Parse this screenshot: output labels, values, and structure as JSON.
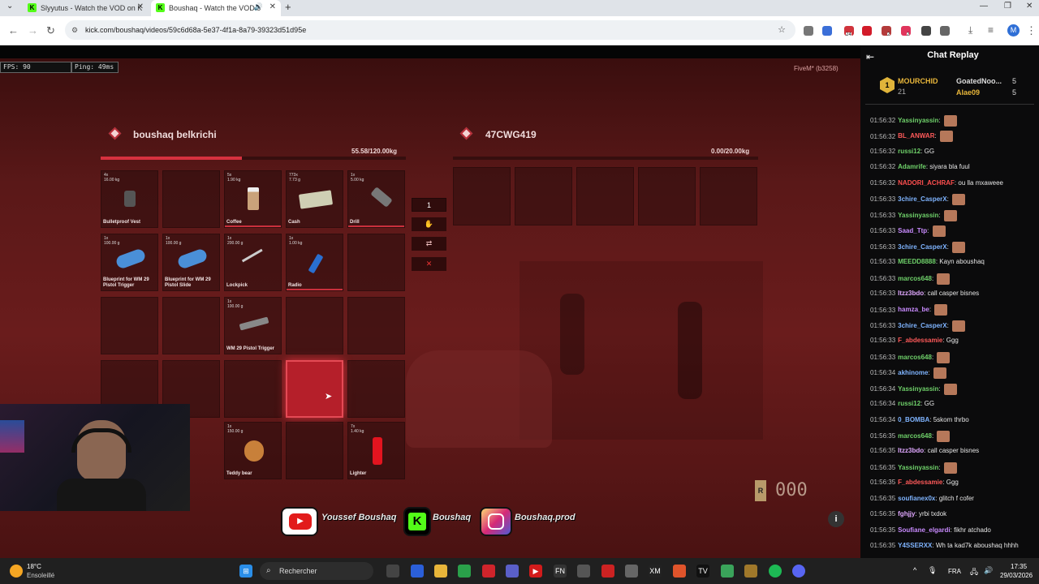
{
  "browser": {
    "tabs": [
      {
        "title": "Slyyutus - Watch the VOD on K",
        "active": false
      },
      {
        "title": "Boushaq - Watch the VOD o",
        "active": true
      }
    ],
    "url": "kick.com/boushaq/videos/59c6d68a-5e37-4f1a-8a79-39323d51d95e",
    "badges": {
      "ext1": "24",
      "ext2": "2",
      "ext3": "2"
    },
    "profile_initial": "M"
  },
  "game": {
    "fps": "FPS: 90",
    "ping": "Ping: 49ms",
    "fivem": "FiveM* (b3258)",
    "player": {
      "name": "boushaq belkrichi",
      "weight": "55.58/120.00kg",
      "weight_fraction": 0.463
    },
    "other": {
      "name": "47CWG419",
      "weight": "0.00/20.00kg",
      "weight_fraction": 0
    },
    "middle_buttons": {
      "amount": "1",
      "give": "✋",
      "swap": "⇄",
      "close": "✕"
    },
    "items": [
      {
        "count": "4x",
        "weight": "16.00 kg",
        "label": "Bulletproof Vest"
      },
      {
        "count": "",
        "weight": "",
        "label": ""
      },
      {
        "count": "5x",
        "weight": "1.90 kg",
        "label": "Coffee"
      },
      {
        "count": "773x",
        "weight": "7.73 g",
        "label": "Cash"
      },
      {
        "count": "1x",
        "weight": "5.00 kg",
        "label": "Drill"
      },
      {
        "count": "1x",
        "weight": "100.00 g",
        "label": "Blueprint for WM 29 Pistol Trigger"
      },
      {
        "count": "1x",
        "weight": "100.00 g",
        "label": "Blueprint for WM 29 Pistol Slide"
      },
      {
        "count": "1x",
        "weight": "200.00 g",
        "label": "Lockpick"
      },
      {
        "count": "1x",
        "weight": "1.00 kg",
        "label": "Radio"
      },
      {
        "count": "",
        "weight": "",
        "label": ""
      },
      {
        "count": "",
        "weight": "",
        "label": ""
      },
      {
        "count": "",
        "weight": "",
        "label": ""
      },
      {
        "count": "1x",
        "weight": "100.00 g",
        "label": "WM 29 Pistol Trigger"
      },
      {
        "count": "",
        "weight": "",
        "label": ""
      },
      {
        "count": "",
        "weight": "",
        "label": ""
      },
      {
        "count": "1x",
        "weight": "150.00 g",
        "label": "Teddy bear"
      },
      {
        "count": "",
        "weight": "",
        "label": ""
      },
      {
        "count": "7x",
        "weight": "1.40 kg",
        "label": "Lighter"
      }
    ],
    "speed": "000",
    "gear": "R"
  },
  "overlay": {
    "youtube": "Youssef Boushaq",
    "kick": "Boushaq",
    "instagram": "Boushaq.prod"
  },
  "chat": {
    "title": "Chat Replay",
    "leaders": [
      {
        "name": "MOURCHID",
        "count": "21",
        "rank": "1"
      },
      {
        "name": "GoatedNoo...",
        "count": "5"
      },
      {
        "name": "Alae09",
        "count": "5"
      }
    ],
    "messages": [
      {
        "ts": "01:56:32",
        "user": "Yassinyassin",
        "text": "",
        "color": "#6fd16a",
        "emote": true
      },
      {
        "ts": "01:56:32",
        "user": "BL_ANWAR",
        "text": "",
        "color": "#ff5a5a",
        "emote": true
      },
      {
        "ts": "01:56:32",
        "user": "russi12",
        "text": "GG",
        "color": "#6fd16a",
        "emote": false
      },
      {
        "ts": "01:56:32",
        "user": "Adamrife",
        "text": "siyara bla fuul",
        "color": "#6fd16a",
        "emote": false
      },
      {
        "ts": "01:56:32",
        "user": "NADORI_ACHRAF",
        "text": "ou lla mxaweee",
        "color": "#ff4f4f",
        "emote": false
      },
      {
        "ts": "01:56:33",
        "user": "3chire_CasperX",
        "text": "",
        "color": "#7fb4ff",
        "emote": true
      },
      {
        "ts": "01:56:33",
        "user": "Yassinyassin",
        "text": "",
        "color": "#6fd16a",
        "emote": true
      },
      {
        "ts": "01:56:33",
        "user": "Saad_Ttp",
        "text": "",
        "color": "#c98bff",
        "emote": true
      },
      {
        "ts": "01:56:33",
        "user": "3chire_CasperX",
        "text": "",
        "color": "#7fb4ff",
        "emote": true
      },
      {
        "ts": "01:56:33",
        "user": "MEEDD8888",
        "text": "Kayn aboushaq",
        "color": "#6fd16a",
        "emote": false
      },
      {
        "ts": "01:56:33",
        "user": "marcos648",
        "text": "",
        "color": "#6fd16a",
        "emote": true
      },
      {
        "ts": "01:56:33",
        "user": "Itzz3bdo",
        "text": "call casper bisnes",
        "color": "#e0a8ff",
        "emote": false
      },
      {
        "ts": "01:56:33",
        "user": "hamza_be",
        "text": "",
        "color": "#c98bff",
        "emote": true
      },
      {
        "ts": "01:56:33",
        "user": "3chire_CasperX",
        "text": "",
        "color": "#7fb4ff",
        "emote": true
      },
      {
        "ts": "01:56:33",
        "user": "F_abdessamie",
        "text": "Ggg",
        "color": "#ff5a5a",
        "emote": false
      },
      {
        "ts": "01:56:33",
        "user": "marcos648",
        "text": "",
        "color": "#6fd16a",
        "emote": true
      },
      {
        "ts": "01:56:34",
        "user": "akhinome",
        "text": "",
        "color": "#7fb4ff",
        "emote": true
      },
      {
        "ts": "01:56:34",
        "user": "Yassinyassin",
        "text": "",
        "color": "#6fd16a",
        "emote": true
      },
      {
        "ts": "01:56:34",
        "user": "russi12",
        "text": "GG",
        "color": "#6fd16a",
        "emote": false
      },
      {
        "ts": "01:56:34",
        "user": "0_BOMBA",
        "text": "5skom thrbo",
        "color": "#7fb4ff",
        "emote": false
      },
      {
        "ts": "01:56:35",
        "user": "marcos648",
        "text": "",
        "color": "#6fd16a",
        "emote": true
      },
      {
        "ts": "01:56:35",
        "user": "Itzz3bdo",
        "text": "call casper bisnes",
        "color": "#e0a8ff",
        "emote": false
      },
      {
        "ts": "01:56:35",
        "user": "Yassinyassin",
        "text": "",
        "color": "#6fd16a",
        "emote": true
      },
      {
        "ts": "01:56:35",
        "user": "F_abdessamie",
        "text": "Ggg",
        "color": "#ff5a5a",
        "emote": false
      },
      {
        "ts": "01:56:35",
        "user": "soufianex0x",
        "text": "glitch f cofer",
        "color": "#7fb4ff",
        "emote": false
      },
      {
        "ts": "01:56:35",
        "user": "fghjjy",
        "text": "yrbi txdok",
        "color": "#e0a8ff",
        "emote": false
      },
      {
        "ts": "01:56:35",
        "user": "Soufiane_elgardi",
        "text": "fikhr atchado",
        "color": "#c98bff",
        "emote": false
      },
      {
        "ts": "01:56:35",
        "user": "Y4SSERXX",
        "text": "Wh ta kad7k aboushaq hhhh",
        "color": "#7fb4ff",
        "emote": false
      }
    ]
  },
  "taskbar": {
    "weather_temp": "18°C",
    "weather_desc": "Ensoleillé",
    "search": "Rechercher",
    "lang": "FRA",
    "time": "17:35",
    "date": "29/03/2026"
  }
}
